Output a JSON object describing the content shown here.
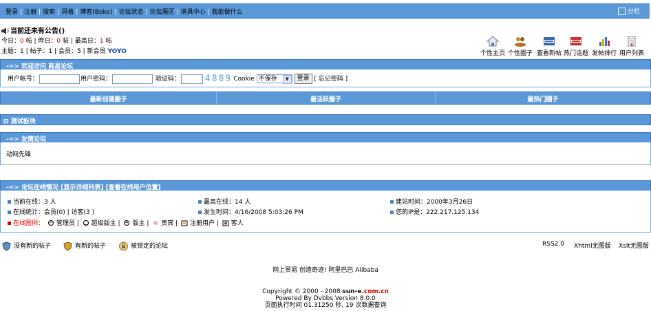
{
  "topnav": {
    "items": [
      "登录",
      "注册",
      "搜索",
      "风格",
      "博客(Boke)",
      "论坛状态",
      "论坛展区",
      "道具中心",
      "我能做什么"
    ],
    "split_label": "分栏"
  },
  "announcement": "当前还未有公告()",
  "stats": {
    "today_label": "今日：",
    "today": "0",
    "today_unit": "帖",
    "yesterday_label": "昨日：",
    "yesterday": "0",
    "yesterday_unit": "帖",
    "max_label": "最高日：",
    "max": "1",
    "max_unit": "帖",
    "topics_label": "主题：",
    "topics": "1",
    "posts_label": "帖子：",
    "posts": "1",
    "members_label": "会员：",
    "members": "5",
    "newmember_label": "新会员",
    "newmember": "YOYO"
  },
  "quicklinks": [
    {
      "label": "个性主页",
      "icon": "home-icon"
    },
    {
      "label": "个性圈子",
      "icon": "people-icon"
    },
    {
      "label": "查看新帖",
      "icon": "new-icon"
    },
    {
      "label": "热门话题",
      "icon": "hot-icon"
    },
    {
      "label": "发帖排行",
      "icon": "chart-icon"
    },
    {
      "label": "用户列表",
      "icon": "list-icon"
    }
  ],
  "welcome": {
    "title": "-=> 欢迎访问 商易论坛"
  },
  "login": {
    "username_label": "用户帐号：",
    "password_label": "用户密码：",
    "captcha_label": "验证码：",
    "captcha_text": "4889",
    "cookie_label": "Cookie",
    "cookie_value": "不保存",
    "login_button": "登录",
    "forgot": "[ 忘记密码 ]"
  },
  "circles": {
    "newest": "最新创建圈子",
    "active": "最活跃圈子",
    "hottest": "最热门圈子"
  },
  "test_board": "测试板块",
  "friend": {
    "title": "-=> 友情论坛",
    "link": "动网先锋"
  },
  "online": {
    "title": "-=> 论坛在线情况 [显示详细列表] [查看在线用户位置]",
    "current": "当前在线：3 人",
    "peak": "最高在线：14 人",
    "founded": "建站时间：2000年3月26日",
    "stat": "在线统计：会员(0) | 访客(3 )",
    "occurred": "发生时间：4/16/2008 5:03:26 PM",
    "ip": "您的IP是：222.217.125.134",
    "legend_label": "在线图例：",
    "legend": [
      "管理员",
      "超级版主",
      "版主",
      "贵宾",
      "注册用户",
      "客人"
    ]
  },
  "status": {
    "new_posts": "没有新的帖子",
    "has_new": "有新的帖子",
    "locked": "被锁定的论坛"
  },
  "feeds": [
    "RSS2.0",
    "Xhtml无图版",
    "Xslt无图版"
  ],
  "footer": {
    "slogan": "网上贸易 创造奇迹! 阿里巴巴 Alibaba",
    "copyright_prefix": "Copyright © 2000 - 2008 ",
    "brand_a": "sun-e",
    "brand_b": ".com.cn",
    "powered": "Powered By Dvbbs Version 8.0.0",
    "exec": "页面执行时间 01.31250 秒, 19 次数据查询"
  },
  "colors": {
    "bar": "#5a98d8",
    "accent_red": "#cc0000",
    "member": "#1a3ea8"
  }
}
